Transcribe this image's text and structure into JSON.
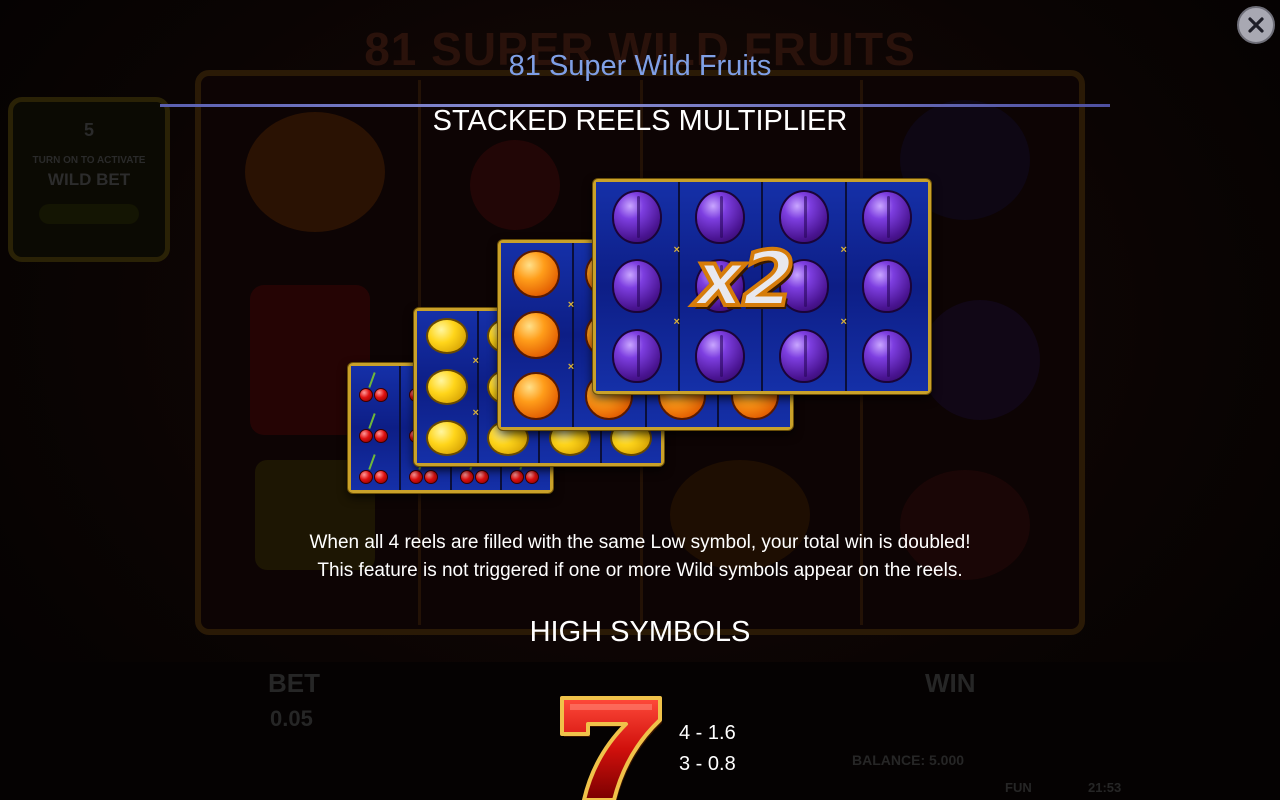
{
  "background": {
    "game_title": "81 SUPER WILD FRUITS",
    "wild_panel": {
      "number": "5",
      "line1": "TURN ON TO ACTIVATE",
      "line2": "WILD BET"
    },
    "bet_label": "BET",
    "bet_value": "0.05",
    "win_label": "WIN",
    "balance": "BALANCE: 5.000",
    "mode": "FUN",
    "clock": "21:53"
  },
  "overlay": {
    "title": "81 Super Wild Fruits",
    "close_icon": "close-icon",
    "feature": {
      "heading": "STACKED REELS MULTIPLIER",
      "multiplier": "x2",
      "description_line1": "When all 4 reels are filled with the same Low symbol, your total win is doubled!",
      "description_line2": "This feature is not triggered if one or more Wild symbols appear on the reels."
    },
    "high_symbols": {
      "heading": "HIGH SYMBOLS",
      "symbol_icon": "seven-icon",
      "payouts": [
        "4 - 1.6",
        "3 - 0.8"
      ]
    }
  },
  "colors": {
    "title_blue": "#7f9fe6",
    "card_gold": "#c9a12a",
    "card_blue": "#0f1f7a"
  }
}
